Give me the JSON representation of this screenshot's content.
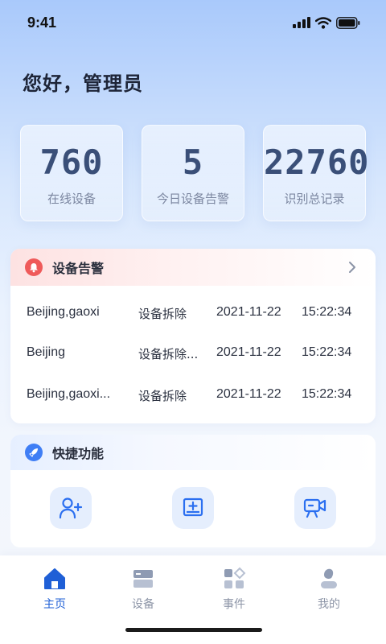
{
  "status_bar": {
    "time": "9:41"
  },
  "greeting": "您好，管理员",
  "stats": [
    {
      "value": "760",
      "label": "在线设备"
    },
    {
      "value": "5",
      "label": "今日设备告警"
    },
    {
      "value": "22760",
      "label": "识别总记录"
    }
  ],
  "alarm": {
    "title": "设备告警",
    "rows": [
      {
        "location": "Beijing,gaoxi",
        "type": "设备拆除",
        "date": "2021-11-22",
        "time": "15:22:34"
      },
      {
        "location": "Beijing",
        "type": "设备拆除...",
        "date": "2021-11-22",
        "time": "15:22:34"
      },
      {
        "location": "Beijing,gaoxi...",
        "type": "设备拆除",
        "date": "2021-11-22",
        "time": "15:22:34"
      }
    ]
  },
  "quick": {
    "title": "快捷功能",
    "buttons": [
      {
        "icon": "add-user-icon"
      },
      {
        "icon": "add-device-icon"
      },
      {
        "icon": "camera-icon"
      }
    ]
  },
  "tabs": [
    {
      "label": "主页",
      "icon": "home-icon",
      "active": true
    },
    {
      "label": "设备",
      "icon": "device-icon",
      "active": false
    },
    {
      "label": "事件",
      "icon": "event-icon",
      "active": false
    },
    {
      "label": "我的",
      "icon": "profile-icon",
      "active": false
    }
  ],
  "colors": {
    "accent": "#1f5fd6",
    "alert": "#ef5a5a",
    "stat_value": "#3a4f78"
  }
}
